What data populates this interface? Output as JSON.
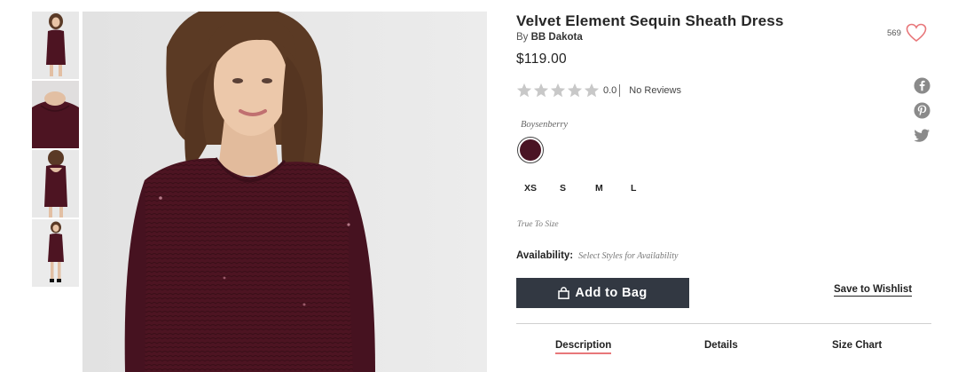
{
  "product": {
    "title": "Velvet Element Sequin Sheath Dress",
    "by_prefix": "By",
    "brand": "BB Dakota",
    "price": "$119.00",
    "favorite_count": "569"
  },
  "rating": {
    "value": "0.0",
    "stars_filled": 0,
    "stars_total": 5,
    "reviews_label": "No Reviews"
  },
  "color": {
    "name": "Boysenberry",
    "swatch_hex": "#4a1424"
  },
  "sizes": [
    "XS",
    "S",
    "M",
    "L"
  ],
  "fit_note": "True To Size",
  "availability": {
    "label": "Availability:",
    "value": "Select Styles for Availability"
  },
  "actions": {
    "add_to_bag": "Add to Bag",
    "save_to_wishlist": "Save to Wishlist"
  },
  "tabs": [
    "Description",
    "Details",
    "Size Chart"
  ],
  "social": [
    "facebook-icon",
    "pinterest-icon",
    "twitter-icon"
  ],
  "colors": {
    "button_bg": "#323842",
    "tab_underline": "#e8777a",
    "heart": "#e8777a",
    "star_empty": "#c8c8c8",
    "dress": "#4d1422"
  }
}
